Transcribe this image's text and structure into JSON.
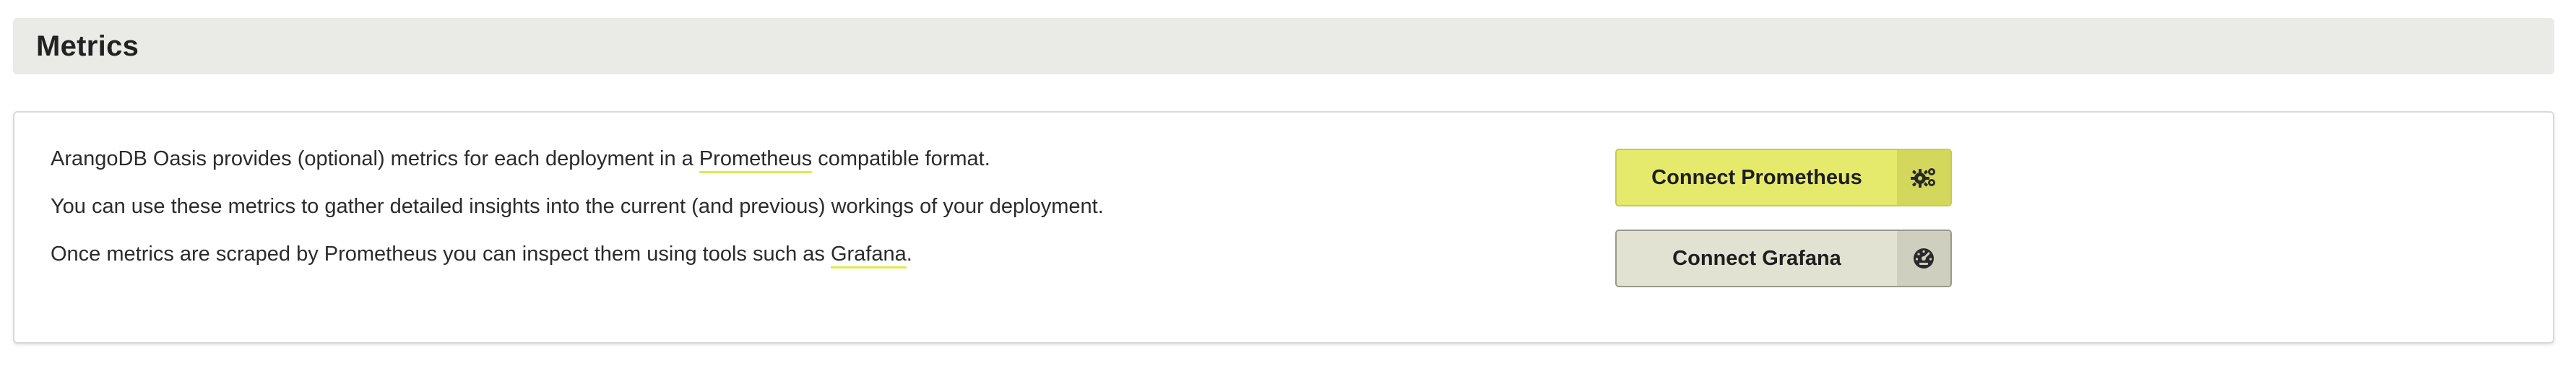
{
  "header": {
    "title": "Metrics"
  },
  "card": {
    "line1_before": "ArangoDB Oasis provides (optional) metrics for each deployment in a ",
    "line1_link": "Prometheus",
    "line1_after": " compatible format.",
    "line2": "You can use these metrics to gather detailed insights into the current (and previous) workings of your deployment.",
    "line3_before": "Once metrics are scraped by Prometheus you can inspect them using tools such as ",
    "line3_link": "Grafana",
    "line3_after": "."
  },
  "buttons": {
    "prometheus": {
      "label": "Connect Prometheus",
      "icon": "gears-icon"
    },
    "grafana": {
      "label": "Connect Grafana",
      "icon": "dashboard-icon"
    }
  },
  "colors": {
    "accent": "#e6ea6c",
    "link_underline": "#e1e84f",
    "header_bg": "#eaeae6"
  }
}
